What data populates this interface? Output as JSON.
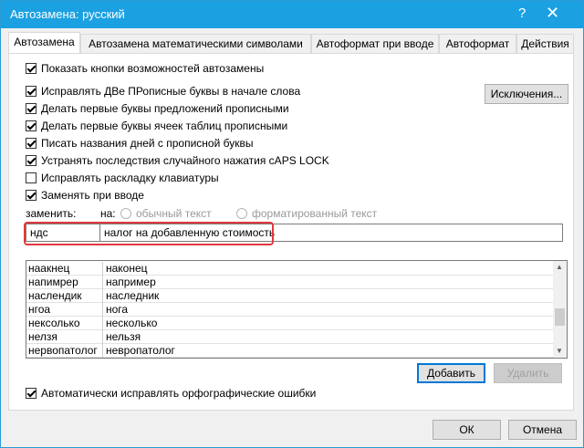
{
  "window": {
    "title": "Автозамена: русский",
    "help_glyph": "?",
    "close_glyph": "✕"
  },
  "tabs": [
    {
      "label": "Автозамена"
    },
    {
      "label": "Автозамена математическими символами"
    },
    {
      "label": "Автоформат при вводе"
    },
    {
      "label": "Автоформат"
    },
    {
      "label": "Действия"
    }
  ],
  "options": {
    "show_buttons": "Показать кнопки возможностей автозамены",
    "two_caps": "Исправлять ДВе ПРописные буквы в начале слова",
    "sentence_caps": "Делать первые буквы предложений прописными",
    "table_caps": "Делать первые буквы ячеек таблиц прописными",
    "day_names": "Писать названия дней с прописной буквы",
    "caps_lock": "Устранять последствия случайного нажатия cAPS LOCK",
    "keyboard_layout": "Исправлять раскладку клавиатуры",
    "replace_typing": "Заменять при вводе",
    "auto_spelling": "Автоматически исправлять орфографические ошибки"
  },
  "exceptions_button": "Исключения...",
  "replace_label": "заменить:",
  "with_label": "на:",
  "radio_plain": "обычный текст",
  "radio_formatted": "форматированный текст",
  "replace_value": "ндс",
  "with_value": "налог на добавленную стоимость",
  "list": [
    {
      "from": "наакнец",
      "to": "наконец"
    },
    {
      "from": "напимрер",
      "to": "например"
    },
    {
      "from": "наслендик",
      "to": "наследник"
    },
    {
      "from": "нгоа",
      "to": "нога"
    },
    {
      "from": "нексолько",
      "to": "несколько"
    },
    {
      "from": "нелзя",
      "to": "нельзя"
    },
    {
      "from": "нервопатолог",
      "to": "невропатолог"
    }
  ],
  "add_button": "Добавить",
  "delete_button": "Удалить",
  "ok_button": "ОК",
  "cancel_button": "Отмена",
  "scroll": {
    "up_glyph": "▲",
    "down_glyph": "▼"
  },
  "colors": {
    "titlebar": "#1ba1e2",
    "highlight": "#e0393e",
    "focus": "#0078d7"
  }
}
